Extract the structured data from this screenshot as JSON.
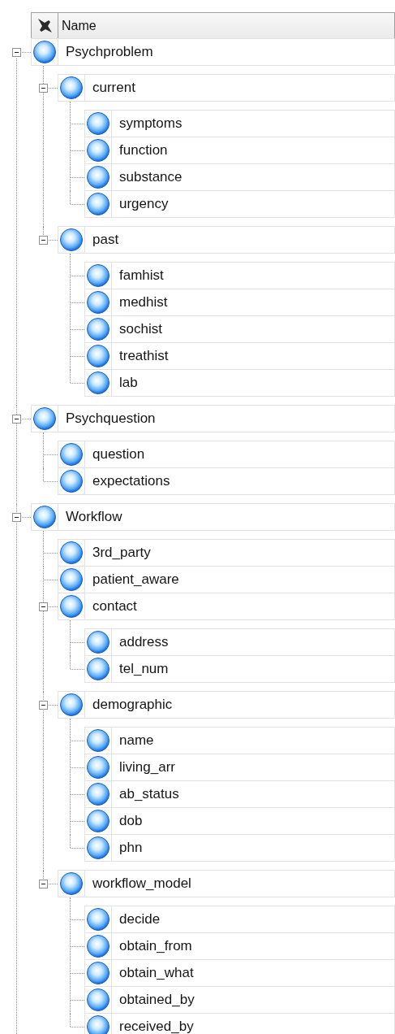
{
  "header": {
    "columns": [
      "Name"
    ]
  },
  "tree": [
    {
      "label": "Psychproblem",
      "expanded": true,
      "children": [
        {
          "label": "current",
          "expanded": true,
          "children": [
            {
              "label": "symptoms"
            },
            {
              "label": "function"
            },
            {
              "label": "substance"
            },
            {
              "label": "urgency"
            }
          ]
        },
        {
          "label": "past",
          "expanded": true,
          "children": [
            {
              "label": "famhist"
            },
            {
              "label": "medhist"
            },
            {
              "label": "sochist"
            },
            {
              "label": "treathist"
            },
            {
              "label": "lab"
            }
          ]
        }
      ]
    },
    {
      "label": "Psychquestion",
      "expanded": true,
      "children": [
        {
          "label": "question"
        },
        {
          "label": "expectations"
        }
      ]
    },
    {
      "label": "Workflow",
      "expanded": true,
      "children": [
        {
          "label": "3rd_party"
        },
        {
          "label": "patient_aware"
        },
        {
          "label": "contact",
          "expanded": true,
          "children": [
            {
              "label": "address"
            },
            {
              "label": "tel_num"
            }
          ]
        },
        {
          "label": "demographic",
          "expanded": true,
          "children": [
            {
              "label": "name"
            },
            {
              "label": "living_arr"
            },
            {
              "label": "ab_status"
            },
            {
              "label": "dob"
            },
            {
              "label": "phn"
            }
          ]
        },
        {
          "label": "workflow_model",
          "expanded": true,
          "children": [
            {
              "label": "decide"
            },
            {
              "label": "obtain_from"
            },
            {
              "label": "obtain_what"
            },
            {
              "label": "obtained_by"
            },
            {
              "label": "received_by"
            }
          ]
        }
      ]
    }
  ]
}
